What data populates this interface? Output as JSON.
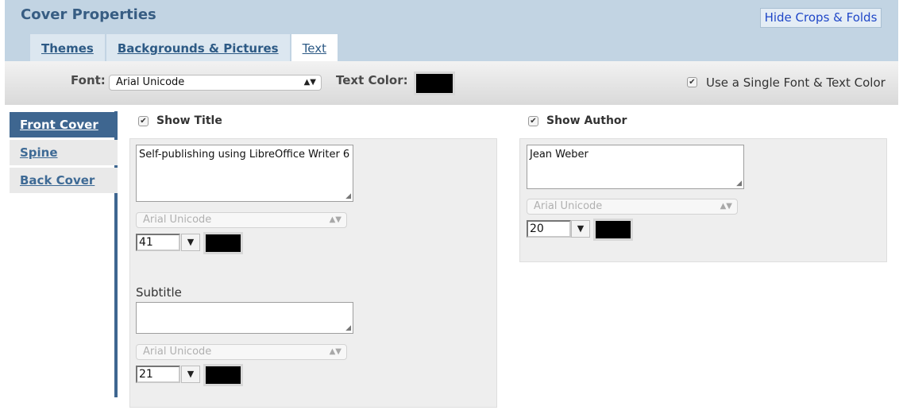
{
  "header": {
    "title": "Cover Properties",
    "hide_button": "Hide Crops & Folds",
    "tabs": [
      {
        "label": "Themes",
        "active": false
      },
      {
        "label": "Backgrounds & Pictures",
        "active": false
      },
      {
        "label": "Text",
        "active": true
      }
    ]
  },
  "toolbar": {
    "font_label": "Font:",
    "font_value": "Arial Unicode",
    "text_color_label": "Text Color:",
    "text_color": "#000000",
    "single_font_label": "Use a Single Font & Text Color",
    "single_font_checked": true
  },
  "nav": {
    "items": [
      {
        "label": "Front Cover",
        "active": true
      },
      {
        "label": "Spine",
        "active": false
      },
      {
        "label": "Back Cover",
        "active": false
      }
    ]
  },
  "title_section": {
    "show_label": "Show Title",
    "checked": true,
    "text": "Self-publishing using LibreOffice Writer 6",
    "font": "Arial Unicode",
    "size": "41",
    "color": "#000000"
  },
  "subtitle_section": {
    "label": "Subtitle",
    "text": "",
    "font": "Arial Unicode",
    "size": "21",
    "color": "#000000"
  },
  "author_section": {
    "show_label": "Show Author",
    "checked": true,
    "text": "Jean Weber",
    "font": "Arial Unicode",
    "size": "20",
    "color": "#000000"
  },
  "icons": {
    "checkmark": "checkmark-icon",
    "select_arrows": "updown-arrows-icon",
    "dropdown": "triangle-down-icon",
    "resize": "resize-handle-icon"
  }
}
